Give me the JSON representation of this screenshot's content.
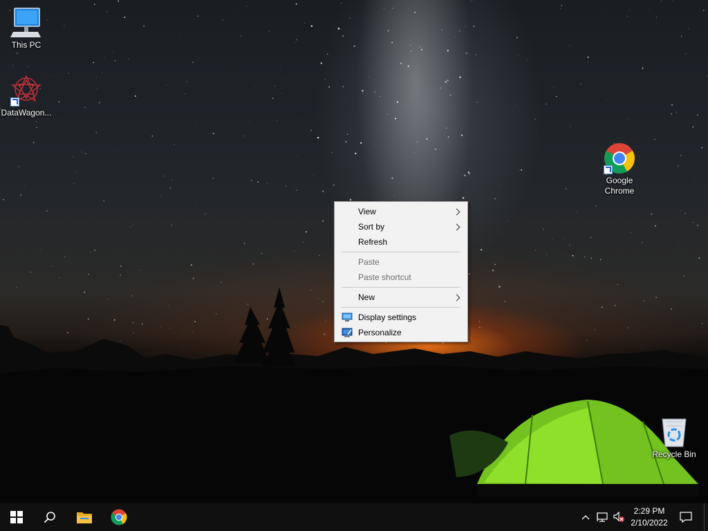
{
  "desktop": {
    "icons": [
      {
        "label": "This PC",
        "icon": "this-pc-icon"
      },
      {
        "label": "DataWagon...",
        "icon": "datawagon-icon"
      },
      {
        "label": "Google Chrome",
        "icon": "chrome-icon"
      },
      {
        "label": "Recycle Bin",
        "icon": "recycle-bin-icon"
      }
    ]
  },
  "context_menu": {
    "items": [
      {
        "label": "View",
        "enabled": true,
        "has_submenu": true
      },
      {
        "label": "Sort by",
        "enabled": true,
        "has_submenu": true
      },
      {
        "label": "Refresh",
        "enabled": true,
        "has_submenu": false
      },
      {
        "label": "Paste",
        "enabled": false,
        "has_submenu": false
      },
      {
        "label": "Paste shortcut",
        "enabled": false,
        "has_submenu": false
      },
      {
        "label": "New",
        "enabled": true,
        "has_submenu": true
      },
      {
        "label": "Display settings",
        "enabled": true,
        "has_submenu": false,
        "icon": "display-settings-icon"
      },
      {
        "label": "Personalize",
        "enabled": true,
        "has_submenu": false,
        "icon": "personalize-icon"
      }
    ]
  },
  "taskbar": {
    "buttons": [
      {
        "icon": "windows-start-icon"
      },
      {
        "icon": "search-icon"
      },
      {
        "icon": "file-explorer-icon"
      },
      {
        "icon": "chrome-icon"
      }
    ],
    "tray": [
      {
        "icon": "chevron-up-icon"
      },
      {
        "icon": "network-icon"
      },
      {
        "icon": "volume-muted-icon"
      }
    ],
    "clock": {
      "time": "2:29 PM",
      "date": "2/10/2022"
    },
    "notification_icon": "action-center-icon"
  },
  "colors": {
    "menu_background": "#f2f2f2",
    "disabled_text": "#6d6d6d",
    "taskbar": "#101010",
    "accent_blue": "#2463b8"
  }
}
